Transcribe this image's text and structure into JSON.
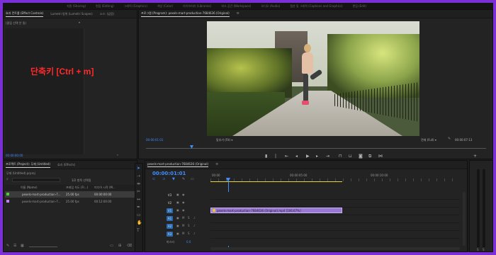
{
  "topbar": {
    "items": [
      "지원 (Sharing)",
      "편집 (Editing)",
      "그래픽 (Graphics)",
      "색상 (Color)",
      "라이브러리 (Libraries)",
      "워크 공간 (Workspace)",
      "오디오 (Audio)",
      "캡션 및 그래픽 (Captions and Graphics)",
      "편집 (Edit)"
    ]
  },
  "source_panel": {
    "tabs": [
      "효과 컨트롤 (Effect Controls)",
      "Lumetri 범위 (Lumetri Scopes)",
      "소스: (없음)"
    ],
    "clip_label": "(클립 선택 안 됨)",
    "annotation": "단축키 [Ctrl + m]",
    "timecode": "00:00:00:00"
  },
  "program_monitor": {
    "title": "프로그램 (Program): pexels-mart-production-7684636 (Original)",
    "timecode": "00:00:01:01",
    "fit_label": "맞추기 (Fit)",
    "quality_label": "전체 (Full)",
    "duration": "00:00:07:13"
  },
  "project_panel": {
    "tabs": [
      "프로젝트 (Project): 무제 (Untitled)",
      "효과 (Effects)"
    ],
    "project_file": "무제 (Untitled).prproj",
    "selection_info": "1/2 항목 선택됨",
    "columns": [
      "이름 (Name)",
      "프레임 속도 (Fr...)",
      "미디어 시작 (M..."
    ],
    "items": [
      {
        "name": "pexels-mart-production-7...",
        "fps": "25.00 fps",
        "start": "00:00:00:00",
        "color": "#4bcc3a"
      },
      {
        "name": "pexels-mart-production-7...",
        "fps": "25.00 fps",
        "start": "00:12:00:00",
        "color": "#c67cf2"
      }
    ]
  },
  "timeline": {
    "title": "pexels-mart-production-7684636 (Original)",
    "timecode": "00:00:01:01",
    "ruler": [
      "00:00",
      "00:00:05:00",
      "00:00:10:00"
    ],
    "video_tracks": [
      "V3",
      "V2",
      "V1"
    ],
    "audio_tracks": [
      "A1",
      "A2",
      "A3"
    ],
    "master_label": "마스터",
    "master_value": "0.0",
    "clip_label": "pexels-mart-production-7684636 (Original).mp4 [106.67%]"
  },
  "colors": {
    "accent": "#3f8dff",
    "annotation": "#ff2a2a",
    "clip": "#9a78d6",
    "border": "#7b2fd6"
  }
}
